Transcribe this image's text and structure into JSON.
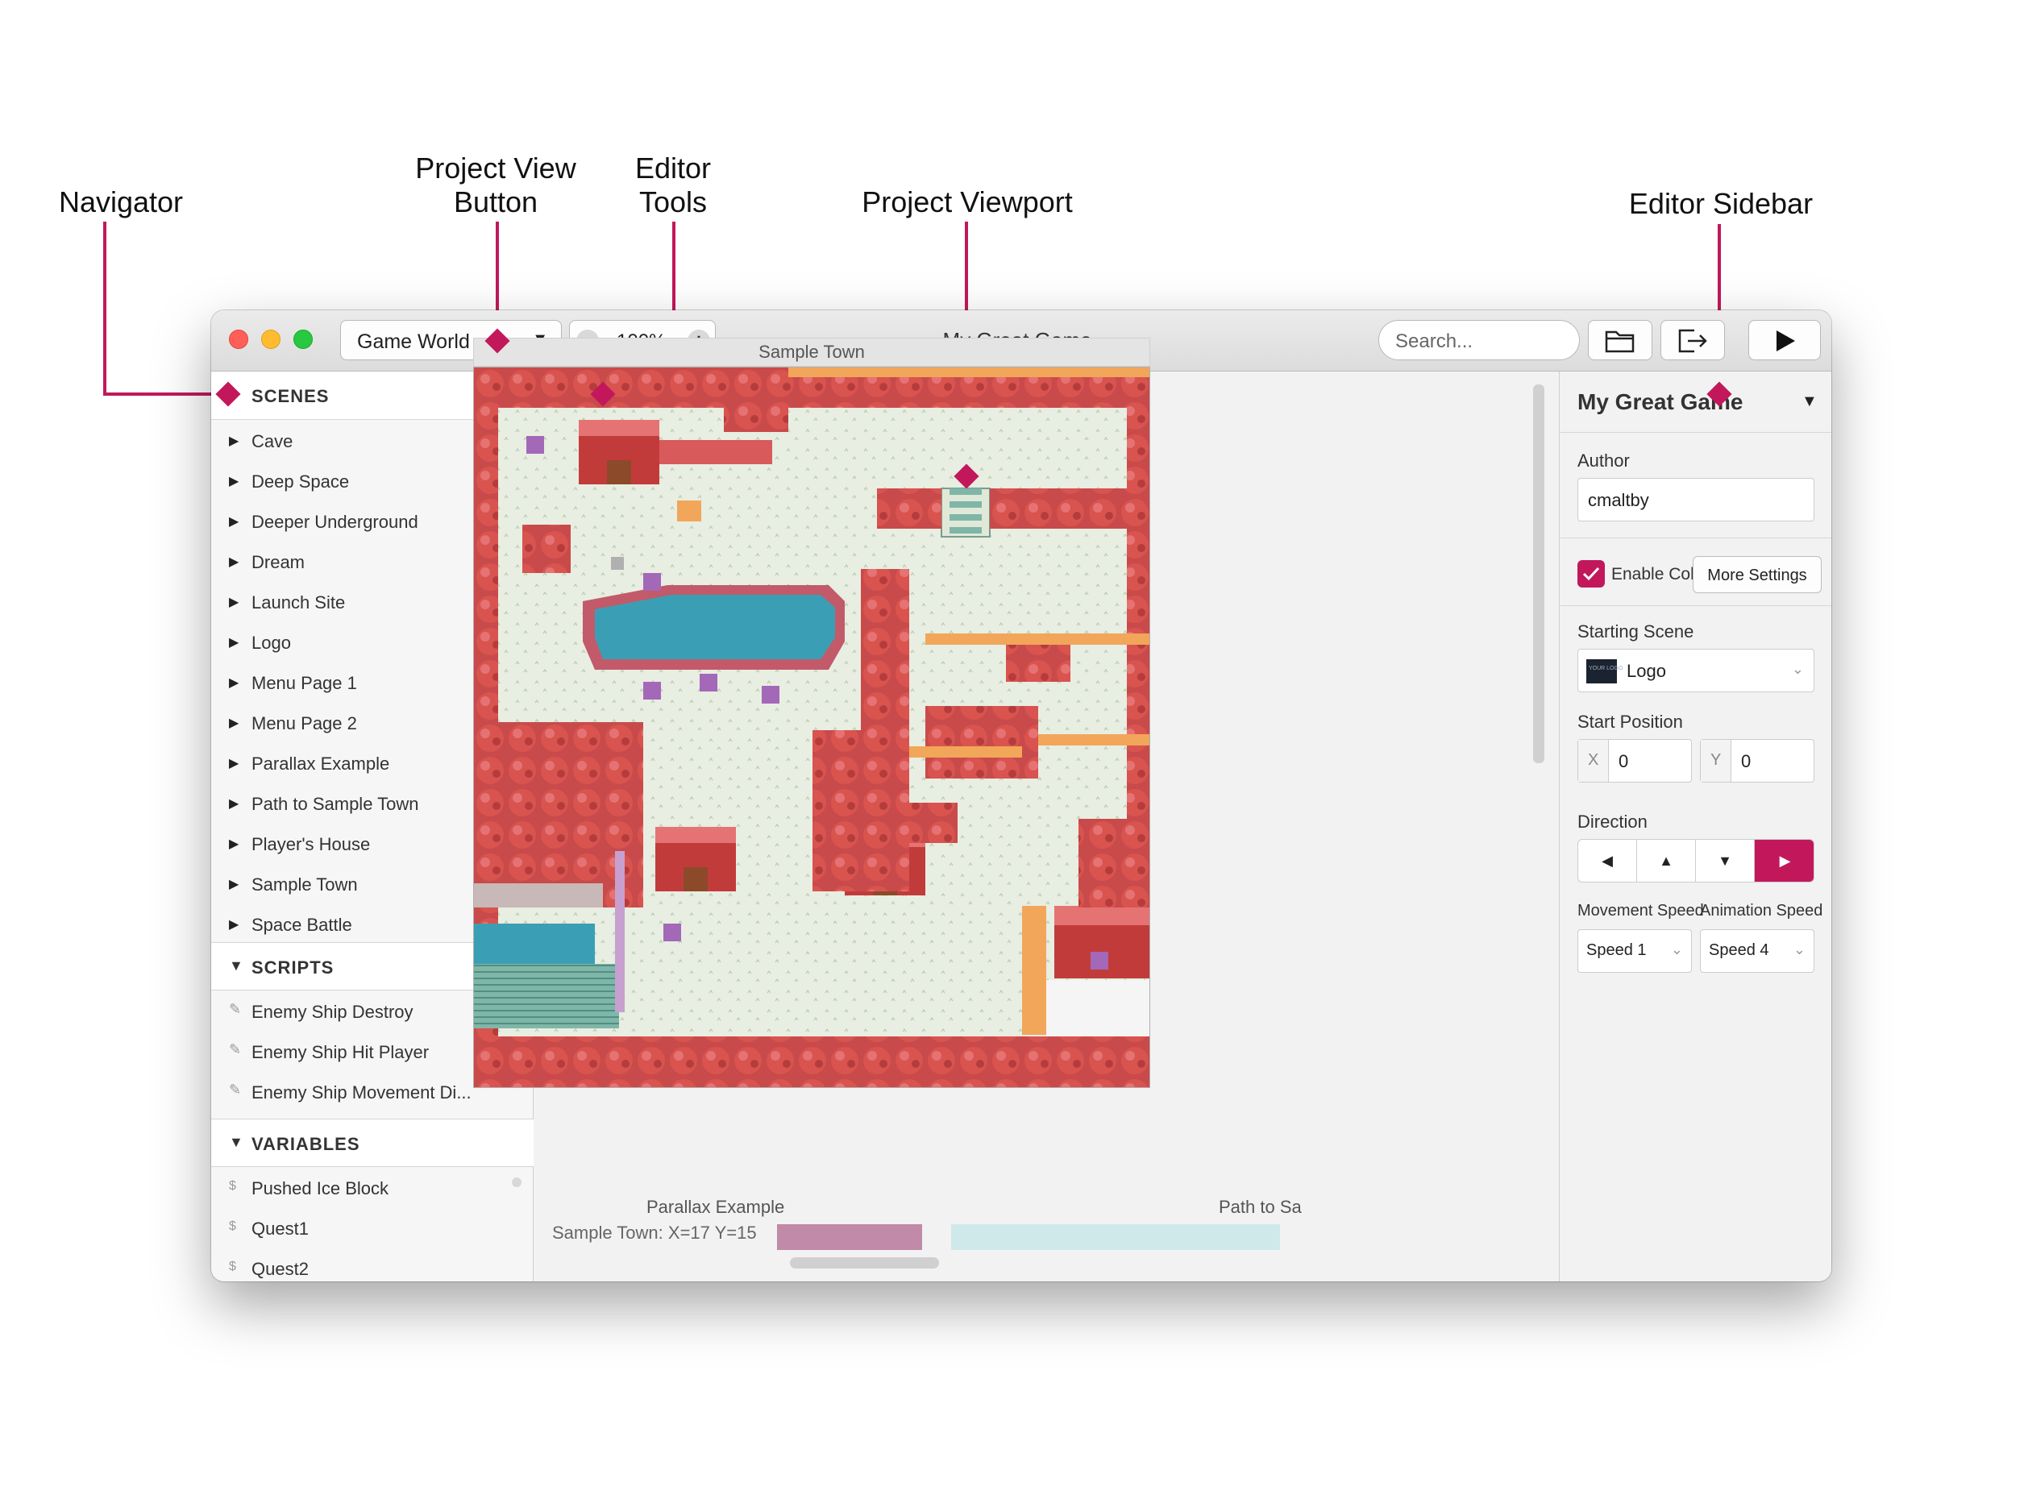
{
  "callouts": {
    "navigator": "Navigator",
    "project_view_button_line1": "Project View",
    "project_view_button_line2": "Button",
    "editor_tools_line1": "Editor",
    "editor_tools_line2": "Tools",
    "project_viewport": "Project Viewport",
    "editor_sidebar": "Editor Sidebar"
  },
  "window": {
    "title": "My Great Game",
    "view_select": "Game World",
    "zoom": "100%",
    "search_placeholder": "Search..."
  },
  "navigator": {
    "scenes": {
      "header": "SCENES",
      "items": [
        "Cave",
        "Deep Space",
        "Deeper Underground",
        "Dream",
        "Launch Site",
        "Logo",
        "Menu Page 1",
        "Menu Page 2",
        "Parallax Example",
        "Path to Sample Town",
        "Player's House",
        "Sample Town",
        "Space Battle"
      ]
    },
    "scripts": {
      "header": "SCRIPTS",
      "items": [
        "Enemy Ship Destroy",
        "Enemy Ship Hit Player",
        "Enemy Ship Movement Di..."
      ]
    },
    "variables": {
      "header": "VARIABLES",
      "items": [
        "Pushed Ice Block",
        "Quest1",
        "Quest2"
      ]
    }
  },
  "tools": {
    "items": [
      "select-icon",
      "add-icon",
      "eraser-icon",
      "collisions-icon",
      "paint-icon"
    ]
  },
  "canvas": {
    "scene_title": "Sample Town",
    "status": "Sample Town: X=17 Y=15",
    "other_scenes": [
      "Parallax Example",
      "Path to Sa"
    ]
  },
  "sidebar": {
    "project_name": "My Great Game",
    "author_label": "Author",
    "author_value": "cmaltby",
    "color_mode_label": "Enable Color Mode",
    "color_mode_checked": true,
    "more_settings": "More Settings",
    "starting_scene_label": "Starting Scene",
    "starting_scene_value": "Logo",
    "logo_thumb_text": "YOUR LOGO",
    "start_position_label": "Start Position",
    "x_label": "X",
    "x_value": "0",
    "y_label": "Y",
    "y_value": "0",
    "direction_label": "Direction",
    "directions": [
      "◀",
      "▲",
      "▼",
      "▶"
    ],
    "direction_selected": "right",
    "movement_speed_label": "Movement Speed",
    "movement_speed_value": "Speed 1",
    "animation_speed_label": "Animation Speed",
    "animation_speed_value": "Speed 4"
  },
  "colors": {
    "accent": "#c2185b",
    "tree": "#d9534f",
    "grass": "#e8eee2",
    "water": "#3a9fb5"
  }
}
